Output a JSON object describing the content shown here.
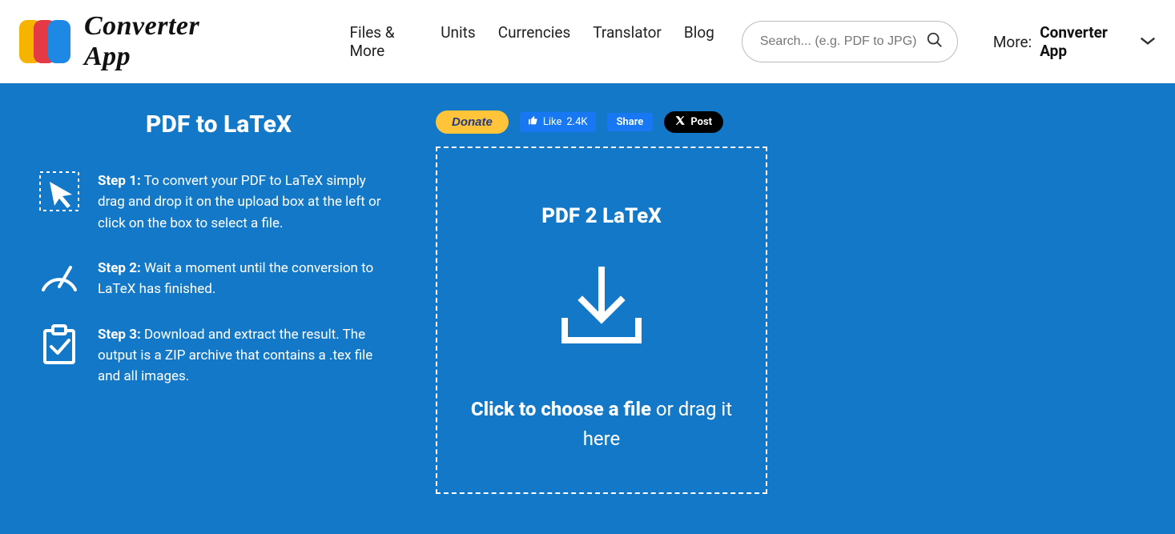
{
  "header": {
    "logo_text": "Converter App",
    "nav": [
      "Files & More",
      "Units",
      "Currencies",
      "Translator",
      "Blog"
    ],
    "search_placeholder": "Search... (e.g. PDF to JPG)",
    "more_label": "More:",
    "more_value": "Converter App"
  },
  "page": {
    "title": "PDF to LaTeX",
    "steps": [
      {
        "label": "Step 1:",
        "text": "To convert your PDF to LaTeX simply drag and drop it on the upload box at the left or click on the box to select a file."
      },
      {
        "label": "Step 2:",
        "text": "Wait a moment until the conversion to LaTeX has finished."
      },
      {
        "label": "Step 3:",
        "text": "Download and extract the result. The output is a ZIP archive that contains a .tex file and all images."
      }
    ]
  },
  "social": {
    "donate": "Donate",
    "like_label": "Like",
    "like_count": "2.4K",
    "share": "Share",
    "xpost": "Post"
  },
  "dropzone": {
    "title": "PDF 2 LaTeX",
    "cta_strong": "Click to choose a file",
    "cta_rest": " or drag it here"
  }
}
